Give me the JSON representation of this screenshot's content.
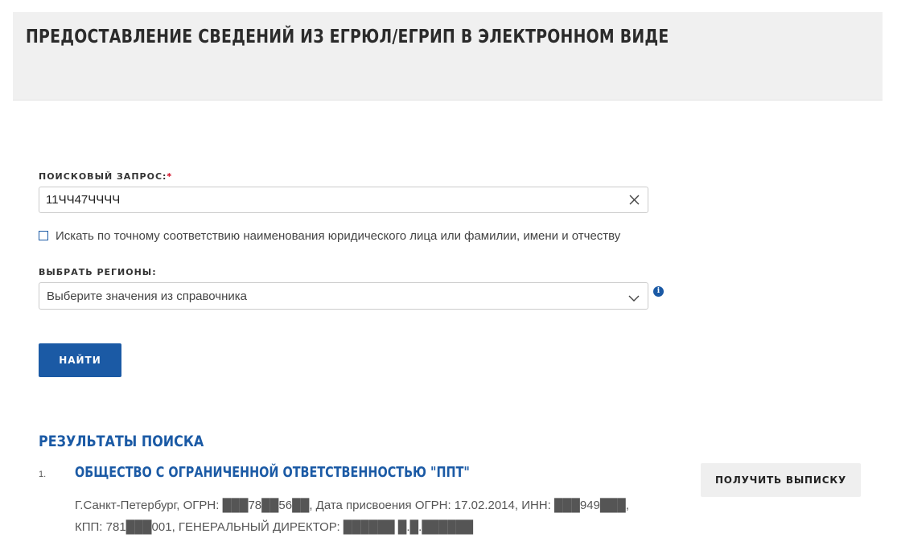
{
  "header": {
    "title": "ПРЕДОСТАВЛЕНИЕ СВЕДЕНИЙ ИЗ ЕГРЮЛ/ЕГРИП В ЭЛЕКТРОННОМ ВИДЕ"
  },
  "search": {
    "label": "ПОИСКОВЫЙ ЗАПРОС:",
    "required_mark": "*",
    "value": "11ЧЧ47ЧЧЧЧ",
    "clear_icon": "close-icon"
  },
  "exact_match": {
    "checked": false,
    "label": "Искать по точному соответствию наименования юридического лица или фамилии, имени и отчеству"
  },
  "regions": {
    "label": "ВЫБРАТЬ РЕГИОНЫ:",
    "placeholder": "Выберите значения из справочника",
    "info_icon_glyph": "i"
  },
  "find_button": {
    "label": "НАЙТИ"
  },
  "results": {
    "title": "РЕЗУЛЬТАТЫ ПОИСКА",
    "items": [
      {
        "number": "1.",
        "name": "ОБЩЕСТВО С ОГРАНИЧЕННОЙ ОТВЕТСТВЕННОСТЬЮ \"ППТ\"",
        "details_line1": "Г.Санкт-Петербург, ОГРН: ███78██56██, Дата присвоения ОГРН: 17.02.2014, ИНН: ███949███,",
        "details_line2": "КПП: 781███001, ГЕНЕРАЛЬНЫЙ ДИРЕКТОР: ██████ █.█.██████",
        "action_label": "ПОЛУЧИТЬ ВЫПИСКУ"
      }
    ]
  },
  "colors": {
    "accent": "#1b5aa5",
    "header_bg": "#f0f0f0",
    "required": "#d0021b"
  }
}
